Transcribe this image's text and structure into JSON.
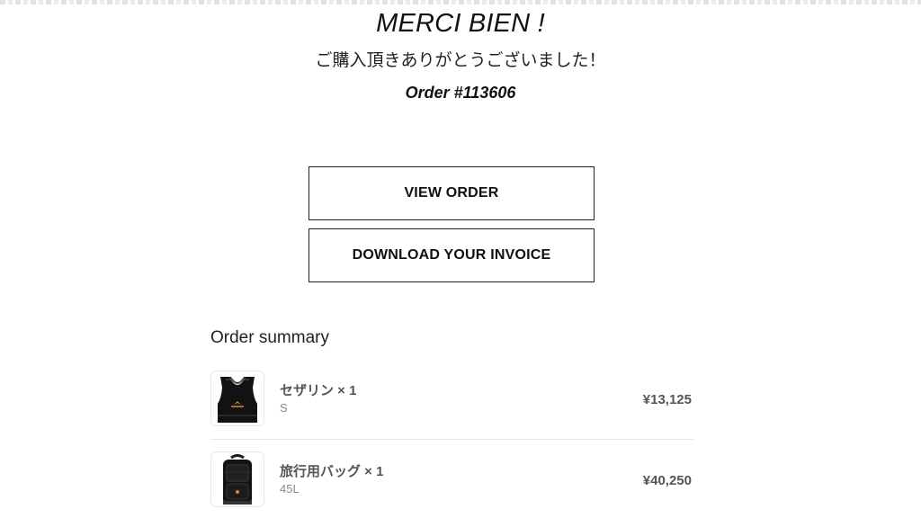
{
  "hero": {
    "title": "MERCI BIEN !",
    "subtitle": "ご購入頂きありがとうございました！",
    "order_number": "Order #113606"
  },
  "actions": {
    "view_order_label": "VIEW ORDER",
    "download_invoice_label": "DOWNLOAD YOUR INVOICE"
  },
  "summary": {
    "title": "Order summary",
    "items": [
      {
        "name": "セザリン × 1",
        "variant": "S",
        "price": "¥13,125",
        "thumbnail_icon": "sports-bra-icon"
      },
      {
        "name": "旅行用バッグ × 1",
        "variant": "45L",
        "price": "¥40,250",
        "thumbnail_icon": "backpack-icon"
      }
    ]
  },
  "colors": {
    "text": "#111111",
    "muted_text": "#555555",
    "variant_text": "#8a8a8a",
    "border": "#222222",
    "divider": "#e7e7e7",
    "background": "#ffffff"
  }
}
